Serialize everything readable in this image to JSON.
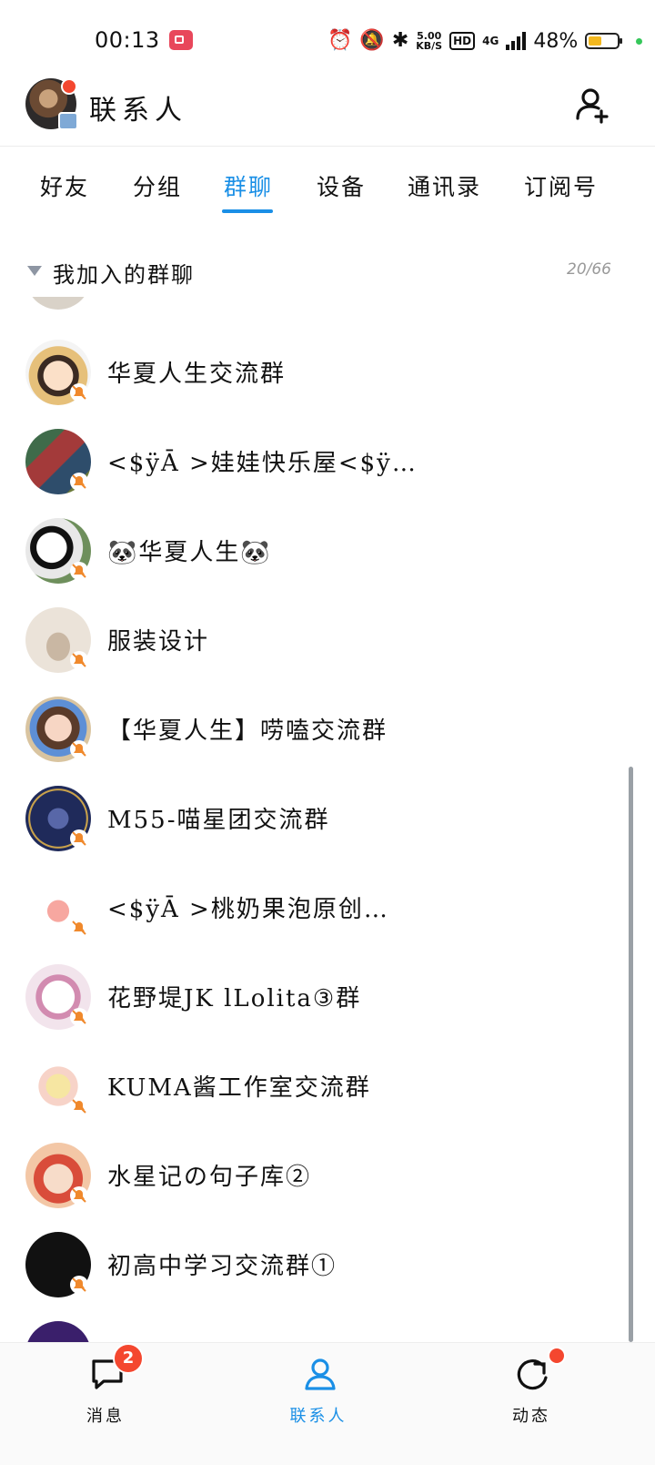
{
  "status_bar": {
    "time": "00:13",
    "net_speed_value": "5.00",
    "net_speed_unit": "KB/S",
    "hd": "HD",
    "network": "4G",
    "battery_pct": "48%",
    "battery_level": 0.48
  },
  "header": {
    "title": "联系人"
  },
  "tabs": [
    {
      "label": "好友"
    },
    {
      "label": "分组"
    },
    {
      "label": "群聊"
    },
    {
      "label": "设备"
    },
    {
      "label": "通讯录"
    },
    {
      "label": "订阅号"
    }
  ],
  "active_tab": "群聊",
  "section": {
    "title": "我加入的群聊",
    "count": "20/66"
  },
  "groups": [
    {
      "name": "华夏人生交流群",
      "avatar": "cartoon-girl-straw-hat"
    },
    {
      "name": "<$ÿĀ      >娃娃快乐屋<$ÿ…",
      "avatar": "pixel-game-scene"
    },
    {
      "name": "🐼华夏人生🐼",
      "avatar": "panda"
    },
    {
      "name": "服装设计",
      "avatar": "dress-sketch"
    },
    {
      "name": "【华夏人生】唠嗑交流群",
      "avatar": "cartoon-girl-bow"
    },
    {
      "name": "M55-喵星团交流群",
      "avatar": "cat-constellation"
    },
    {
      "name": "<$ÿĀ      >桃奶果泡原创…",
      "avatar": "peach-logo"
    },
    {
      "name": "花野堤JK lLolita③群",
      "avatar": "flower-wreath-logo"
    },
    {
      "name": "KUMA酱工作室交流群",
      "avatar": "anime-girl-cat-ears"
    },
    {
      "name": "水星记の句子库②",
      "avatar": "anime-girl-red"
    },
    {
      "name": "初高中学习交流群①",
      "avatar": "black-calligraphy"
    }
  ],
  "bottom_nav": {
    "messages_label": "消息",
    "messages_badge": "2",
    "contacts_label": "联系人",
    "moments_label": "动态"
  },
  "colors": {
    "accent": "#1a8fe6",
    "badge": "#f4472f",
    "mute": "#f0892c"
  }
}
